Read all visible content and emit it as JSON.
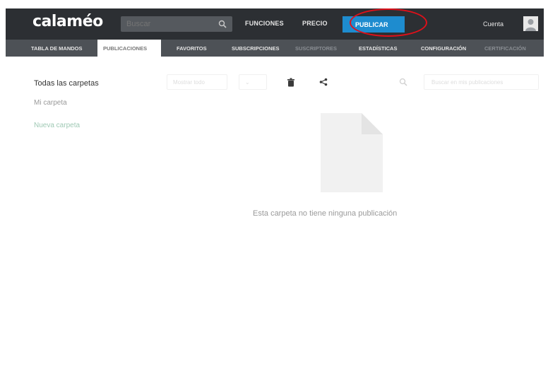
{
  "header": {
    "logo": "calaméo",
    "search_placeholder": "Buscar",
    "nav": [
      "FUNCIONES",
      "PRECIO"
    ],
    "publish_label": "PUBLICAR",
    "account_label": "Cuenta"
  },
  "subnav": {
    "items": [
      {
        "label": "TABLA DE MANDOS",
        "active": false,
        "dim": false
      },
      {
        "label": "PUBLICACIONES",
        "active": true,
        "dim": false
      },
      {
        "label": "FAVORITOS",
        "active": false,
        "dim": false
      },
      {
        "label": "SUBSCRIPCIONES",
        "active": false,
        "dim": false
      },
      {
        "label": "SUSCRIPTORES",
        "active": false,
        "dim": true
      },
      {
        "label": "ESTADÍSTICAS",
        "active": false,
        "dim": false
      },
      {
        "label": "CONFIGURACIÓN",
        "active": false,
        "dim": false
      },
      {
        "label": "CERTIFICACIÓN",
        "active": false,
        "dim": true
      }
    ]
  },
  "sidebar": {
    "title": "Todas las carpetas",
    "my_folder": "Mi carpeta",
    "new_folder": "Nueva carpeta"
  },
  "toolbar": {
    "sort_placeholder": "Mostrar todo",
    "action_placeholder": "⌄",
    "search_placeholder": "Buscar en mis publicaciones"
  },
  "empty_state": {
    "message": "Esta carpeta no tiene ninguna publicación"
  },
  "colors": {
    "topbar": "#2c2f33",
    "subnav": "#4d5156",
    "accent": "#1e8ccf",
    "highlight": "#e0101a"
  }
}
